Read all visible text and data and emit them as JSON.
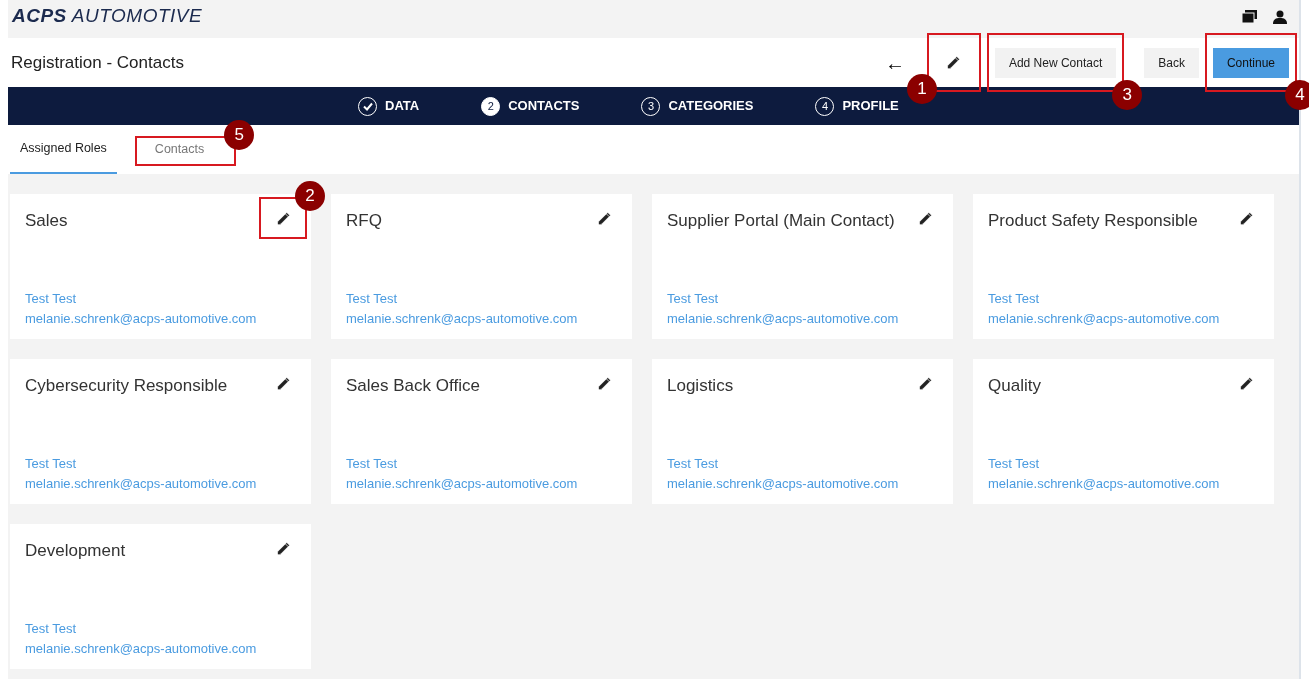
{
  "logo": {
    "bold": "ACPS",
    "rest": "AUTOMOTIVE"
  },
  "header": {
    "title": "Registration - Contacts",
    "back_arrow": "←",
    "edit": {
      "callout": {
        "label": "1",
        "below": true,
        "left": true
      }
    },
    "buttons": [
      {
        "label": "Add New Contact",
        "kind": "secondary",
        "callout": {
          "label": "3",
          "below": true,
          "left": false
        }
      },
      {
        "label": "Back",
        "kind": "secondary"
      },
      {
        "label": "Continue",
        "kind": "primary",
        "callout": {
          "label": "4",
          "below": true,
          "left": false
        }
      }
    ]
  },
  "steps": [
    {
      "label": "DATA",
      "done": true,
      "active": false
    },
    {
      "number": "2",
      "label": "CONTACTS",
      "done": false,
      "active": true
    },
    {
      "number": "3",
      "label": "CATEGORIES",
      "done": false,
      "active": false
    },
    {
      "number": "4",
      "label": "PROFILE",
      "done": false,
      "active": false
    }
  ],
  "tabs": [
    {
      "label": "Assigned Roles",
      "selected": true
    },
    {
      "label": "Contacts",
      "selected": false,
      "callout": {
        "label": "5",
        "below": false,
        "left": false
      }
    }
  ],
  "cards": [
    {
      "title": "Sales",
      "name": "Test Test",
      "email": "melanie.schrenk@acps-automotive.com",
      "edit_callout": {
        "label": "2",
        "below": false,
        "left": false
      }
    },
    {
      "title": "RFQ",
      "name": "Test Test",
      "email": "melanie.schrenk@acps-automotive.com"
    },
    {
      "title": "Supplier Portal (Main Contact)",
      "name": "Test Test",
      "email": "melanie.schrenk@acps-automotive.com"
    },
    {
      "title": "Product Safety Responsible",
      "name": "Test Test",
      "email": "melanie.schrenk@acps-automotive.com"
    },
    {
      "title": "Cybersecurity Responsible",
      "name": "Test Test",
      "email": "melanie.schrenk@acps-automotive.com"
    },
    {
      "title": "Sales Back Office",
      "name": "Test Test",
      "email": "melanie.schrenk@acps-automotive.com"
    },
    {
      "title": "Logistics",
      "name": "Test Test",
      "email": "melanie.schrenk@acps-automotive.com"
    },
    {
      "title": "Quality",
      "name": "Test Test",
      "email": "melanie.schrenk@acps-automotive.com"
    },
    {
      "title": "Development",
      "name": "Test Test",
      "email": "melanie.schrenk@acps-automotive.com"
    }
  ]
}
